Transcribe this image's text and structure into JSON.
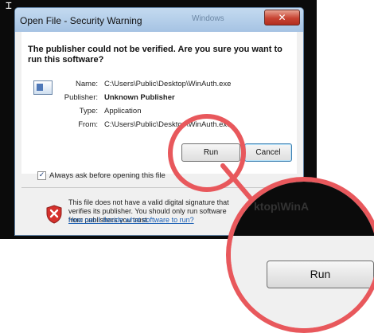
{
  "decor": {
    "cursor_glyph": "⌶"
  },
  "window": {
    "title": "Open File - Security Warning",
    "background_title": "Windows",
    "close_symbol": "✕"
  },
  "dialog": {
    "headline": "The publisher could not be verified.  Are you sure you want to run this software?",
    "file_icon": "exe-file-icon",
    "fields": {
      "name_label": "Name:",
      "name_value": "C:\\Users\\Public\\Desktop\\WinAuth.exe",
      "publisher_label": "Publisher:",
      "publisher_value": "Unknown Publisher",
      "type_label": "Type:",
      "type_value": "Application",
      "from_label": "From:",
      "from_value": "C:\\Users\\Public\\Desktop\\WinAuth.exe"
    },
    "buttons": {
      "run": "Run",
      "cancel": "Cancel"
    },
    "checkbox": {
      "label": "Always ask before opening this file",
      "checked": true,
      "mark": "✓"
    },
    "warning": {
      "icon": "red-shield-x-icon",
      "text": "This file does not have a valid digital signature that verifies its publisher.  You should only run software from publishers you trust.",
      "link": "How can I decide what software to run?"
    }
  },
  "zoom_callout": {
    "path_fragment": "ktop\\WinA",
    "button": "Run",
    "ring_color": "#e8585c"
  }
}
